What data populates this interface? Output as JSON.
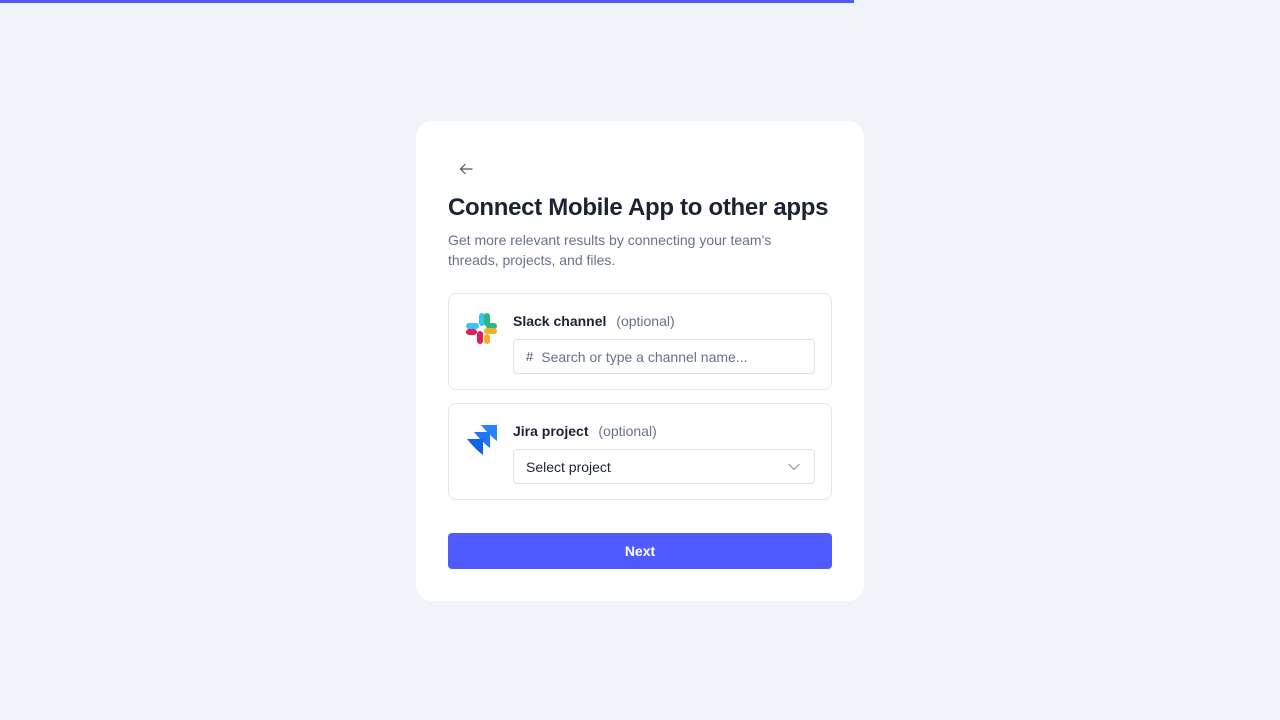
{
  "progress": {
    "fraction": 0.667,
    "color": "#4f5bff"
  },
  "header": {
    "back_icon": "arrow-left-icon",
    "title": "Connect Mobile App to other apps",
    "subtitle": "Get more relevant results by connecting your team's threads, projects, and files."
  },
  "integrations": {
    "slack": {
      "icon": "slack-logo-icon",
      "name": "Slack channel",
      "optional": "(optional)",
      "prefix": "#",
      "value": "",
      "placeholder": "Search or type a channel name..."
    },
    "jira": {
      "icon": "jira-logo-icon",
      "name": "Jira project",
      "optional": "(optional)",
      "selected": "Select project",
      "dropdown_icon": "chevron-down-icon"
    }
  },
  "actions": {
    "next_label": "Next"
  },
  "colors": {
    "accent": "#4f5bff",
    "background": "#f0f3f8",
    "card": "#ffffff",
    "text": "#1c2434",
    "muted": "#66718a"
  }
}
